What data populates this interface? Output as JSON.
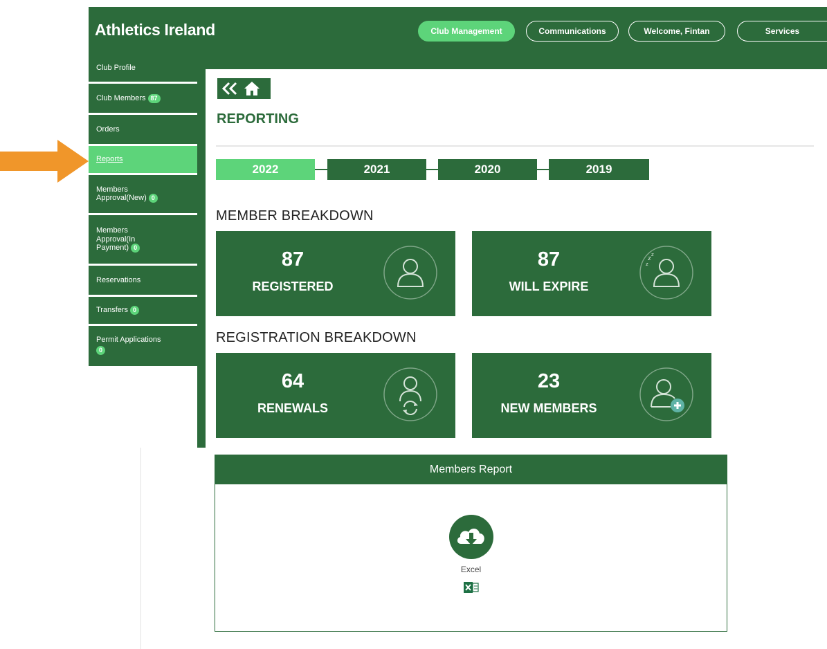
{
  "header": {
    "brand": "Athletics Ireland",
    "nav": [
      "Club Management",
      "Communications",
      "Welcome, Fintan",
      "Services"
    ]
  },
  "sidebar": {
    "items": [
      {
        "label": "Club Profile"
      },
      {
        "label": "Club Members",
        "badge": "87"
      },
      {
        "label": "Orders"
      },
      {
        "label": "Reports",
        "active": true
      },
      {
        "label_lines": [
          "Members",
          "Approval(New)"
        ],
        "badge": "0"
      },
      {
        "label_lines": [
          "Members",
          "Approval(In",
          "Payment)"
        ],
        "badge": "0"
      },
      {
        "label": "Reservations"
      },
      {
        "label": "Transfers",
        "badge": "0"
      },
      {
        "label": "Permit Applications",
        "badge": "0"
      }
    ]
  },
  "main": {
    "title": "REPORTING",
    "years": [
      "2022",
      "2021",
      "2020",
      "2019"
    ],
    "selected_year": "2022",
    "member_breakdown": {
      "heading": "MEMBER BREAKDOWN",
      "cards": [
        {
          "value": "87",
          "label": "REGISTERED",
          "icon": "user-icon"
        },
        {
          "value": "87",
          "label": "WILL EXPIRE",
          "icon": "user-sleep-icon"
        }
      ]
    },
    "registration_breakdown": {
      "heading": "REGISTRATION BREAKDOWN",
      "cards": [
        {
          "value": "64",
          "label": "RENEWALS",
          "icon": "user-renew-icon"
        },
        {
          "value": "23",
          "label": "NEW MEMBERS",
          "icon": "user-add-icon"
        }
      ]
    }
  },
  "report": {
    "title": "Members Report",
    "format_label": "Excel"
  },
  "colors": {
    "primary": "#2c6b3b",
    "accent": "#5dd47a",
    "arrow": "#f0962a"
  }
}
